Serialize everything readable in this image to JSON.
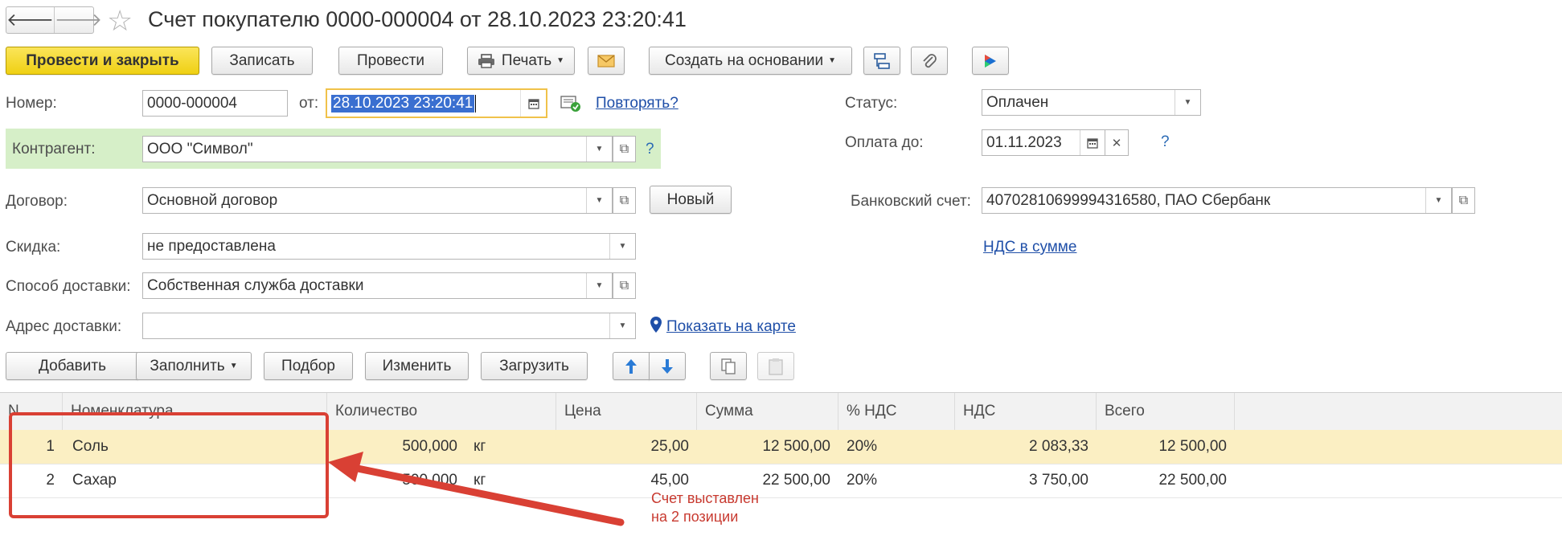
{
  "window": {
    "title": "Счет покупателю 0000-000004 от 28.10.2023 23:20:41",
    "nav_back": "🡐",
    "nav_forward": "🡒",
    "favorite": "☆"
  },
  "toolbar": {
    "post_close": "Провести и закрыть",
    "save": "Записать",
    "post": "Провести",
    "print": "Печать",
    "create_based": "Создать на основании"
  },
  "form": {
    "number_label": "Номер:",
    "number_value": "0000-000004",
    "date_label": "от:",
    "date_value": "28.10.2023 23:20:41",
    "repeat_link": "Повторять?",
    "status_label": "Статус:",
    "status_value": "Оплачен",
    "pay_until_label": "Оплата до:",
    "pay_until_value": "01.11.2023",
    "pay_help": "?",
    "counterparty_label": "Контрагент:",
    "counterparty_value": "ООО \"Символ\"",
    "counterparty_help": "?",
    "contract_label": "Договор:",
    "contract_value": "Основной договор",
    "new_button": "Новый",
    "bank_label": "Банковский счет:",
    "bank_value": "40702810699994316580, ПАО Сбербанк",
    "discount_label": "Скидка:",
    "discount_value": "не предоставлена",
    "vat_link": "НДС в сумме",
    "delivery_method_label": "Способ доставки:",
    "delivery_method_value": "Собственная служба доставки",
    "delivery_address_label": "Адрес доставки:",
    "delivery_address_value": "",
    "map_link": "Показать на карте"
  },
  "table_toolbar": {
    "add": "Добавить",
    "fill": "Заполнить",
    "select": "Подбор",
    "edit": "Изменить",
    "load": "Загрузить"
  },
  "table": {
    "columns": [
      "N",
      "Номенклатура",
      "Количество",
      "Цена",
      "Сумма",
      "% НДС",
      "НДС",
      "Всего"
    ],
    "rows": [
      {
        "n": "1",
        "item": "Соль",
        "qty": "500,000",
        "unit": "кг",
        "price": "25,00",
        "sum": "12 500,00",
        "vat_rate": "20%",
        "vat": "2 083,33",
        "total": "12 500,00"
      },
      {
        "n": "2",
        "item": "Сахар",
        "qty": "500,000",
        "unit": "кг",
        "price": "45,00",
        "sum": "22 500,00",
        "vat_rate": "20%",
        "vat": "3 750,00",
        "total": "22 500,00"
      }
    ]
  },
  "annotation": {
    "line1": "Счет выставлен",
    "line2": "на 2 позиции"
  },
  "colors": {
    "primary_button": "#f2d31b",
    "counterparty_highlight": "#d6efc8",
    "selected_row": "#fbefc3",
    "annotation": "#d94034",
    "link": "#1f4fa8"
  }
}
